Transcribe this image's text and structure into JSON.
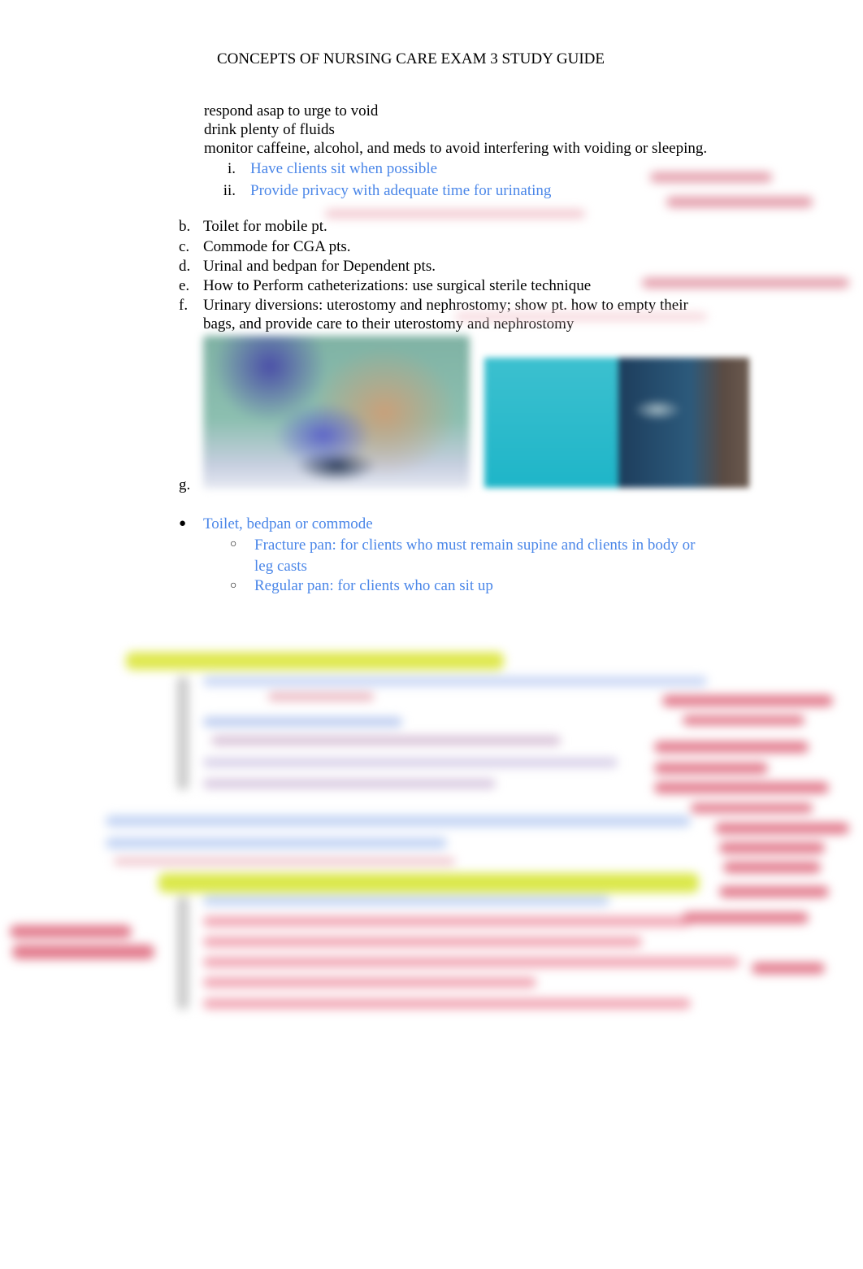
{
  "document": {
    "title": "CONCEPTS OF NURSING CARE EXAM 3 STUDY GUIDE",
    "intro_lines": [
      "respond asap to urge to void",
      "drink plenty of fluids",
      "monitor caffeine, alcohol, and meds to avoid interfering with voiding or sleeping."
    ],
    "roman_items": [
      {
        "marker": "i.",
        "text": "Have clients sit when possible"
      },
      {
        "marker": "ii.",
        "text": "Provide privacy with adequate time for urinating"
      }
    ],
    "lettered_items": [
      {
        "marker": "b.",
        "lines": [
          "Toilet for mobile pt."
        ]
      },
      {
        "marker": "c.",
        "lines": [
          "Commode for CGA pts."
        ]
      },
      {
        "marker": "d.",
        "lines": [
          "Urinal and bedpan for Dependent pts."
        ]
      },
      {
        "marker": "e.",
        "lines": [
          "How to Perform catheterizations: use surgical sterile technique"
        ]
      },
      {
        "marker": "f.",
        "lines": [
          "Urinary diversions: uterostomy and nephrostomy; show pt. how to empty their",
          "bags, and provide care to their uterostomy and nephrostomy"
        ]
      },
      {
        "marker": "g.",
        "lines": [
          ""
        ]
      }
    ],
    "images": [
      {
        "alt": "patient-with-oxygen-mask-photo"
      },
      {
        "alt": "urinary-drainage-bag-photo"
      }
    ],
    "bullet": {
      "marker": "●",
      "text": "Toilet, bedpan or commode",
      "sub_items": [
        {
          "marker": "○",
          "lines": [
            "Fracture pan:  for clients who must remain supine and clients in body or",
            "leg casts"
          ]
        },
        {
          "marker": "○",
          "lines": [
            "Regular pan: for clients who can sit up"
          ]
        }
      ]
    },
    "blurred_section_note": ""
  },
  "colors": {
    "text": "#000000",
    "blue_text": "#4a86e8",
    "highlight": "#d6e84a",
    "annotation_red": "#d9485f"
  }
}
